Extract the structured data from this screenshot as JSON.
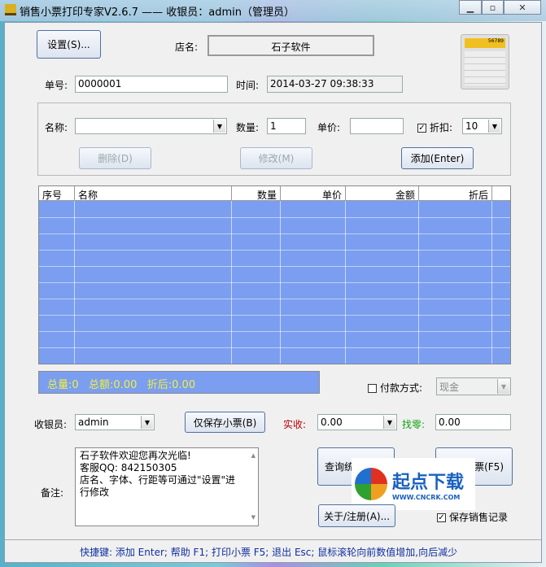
{
  "window": {
    "title": "销售小票打印专家V2.6.7 —— 收银员：admin（管理员）"
  },
  "top": {
    "settings_btn": "设置(S)...",
    "store_label": "店名:",
    "store_name": "石子软件",
    "order_label": "单号:",
    "order_no": "0000001",
    "time_label": "时间:",
    "time_value": "2014-03-27 09:38:33"
  },
  "entry": {
    "name_label": "名称:",
    "name_value": "",
    "qty_label": "数量:",
    "qty_value": "1",
    "price_label": "单价:",
    "price_value": "",
    "discount_label": "折扣:",
    "discount_checked": true,
    "discount_value": "10",
    "delete_btn": "删除(D)",
    "modify_btn": "修改(M)",
    "add_btn": "添加(Enter)"
  },
  "table": {
    "columns": [
      "序号",
      "名称",
      "数量",
      "单价",
      "金额",
      "折后"
    ],
    "rows": []
  },
  "summary": {
    "text": "总量:0   总额:0.00   折后:0.00",
    "payment_label": "付款方式:",
    "payment_value": "现金"
  },
  "cash": {
    "cashier_label": "收银员:",
    "cashier_value": "admin",
    "save_only_btn": "仅保存小票(B)",
    "received_label": "实收:",
    "received_value": "0.00",
    "change_label": "找零:",
    "change_value": "0.00",
    "received_color": "#c00000",
    "change_color": "#10a010"
  },
  "memo": {
    "label": "备注:",
    "lines": [
      "石子软件欢迎您再次光临!",
      "客服QQ: 842150305",
      "店名、字体、行距等可通过\"设置\"进",
      "行修改"
    ]
  },
  "actions": {
    "query_btn": "查询统",
    "print_btn": "票(F5)",
    "about_btn": "关于/注册(A)...",
    "save_record_label": "保存销售记录",
    "save_record_checked": true
  },
  "footer": {
    "shortcuts": "快捷键:  添加 Enter; 帮助 F1; 打印小票 F5; 退出 Esc; 鼠标滚轮向前数值增加,向后减少"
  },
  "watermark": {
    "name": "起点下载",
    "url": "WWW.CNCRK.COM"
  }
}
